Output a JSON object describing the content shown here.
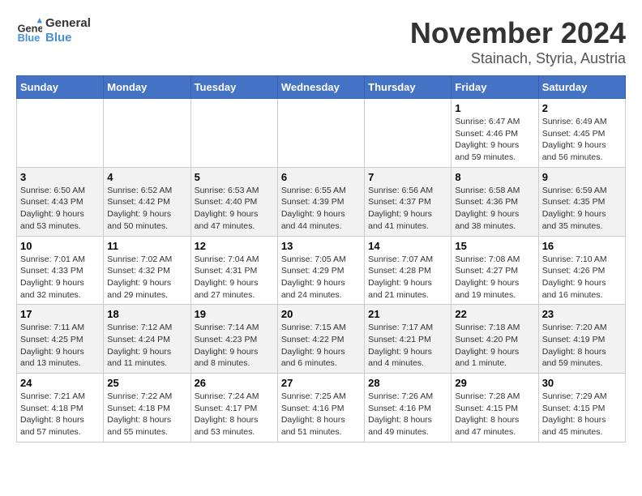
{
  "logo": {
    "line1": "General",
    "line2": "Blue"
  },
  "title": "November 2024",
  "location": "Stainach, Styria, Austria",
  "days_of_week": [
    "Sunday",
    "Monday",
    "Tuesday",
    "Wednesday",
    "Thursday",
    "Friday",
    "Saturday"
  ],
  "weeks": [
    [
      {
        "day": "",
        "info": ""
      },
      {
        "day": "",
        "info": ""
      },
      {
        "day": "",
        "info": ""
      },
      {
        "day": "",
        "info": ""
      },
      {
        "day": "",
        "info": ""
      },
      {
        "day": "1",
        "info": "Sunrise: 6:47 AM\nSunset: 4:46 PM\nDaylight: 9 hours and 59 minutes."
      },
      {
        "day": "2",
        "info": "Sunrise: 6:49 AM\nSunset: 4:45 PM\nDaylight: 9 hours and 56 minutes."
      }
    ],
    [
      {
        "day": "3",
        "info": "Sunrise: 6:50 AM\nSunset: 4:43 PM\nDaylight: 9 hours and 53 minutes."
      },
      {
        "day": "4",
        "info": "Sunrise: 6:52 AM\nSunset: 4:42 PM\nDaylight: 9 hours and 50 minutes."
      },
      {
        "day": "5",
        "info": "Sunrise: 6:53 AM\nSunset: 4:40 PM\nDaylight: 9 hours and 47 minutes."
      },
      {
        "day": "6",
        "info": "Sunrise: 6:55 AM\nSunset: 4:39 PM\nDaylight: 9 hours and 44 minutes."
      },
      {
        "day": "7",
        "info": "Sunrise: 6:56 AM\nSunset: 4:37 PM\nDaylight: 9 hours and 41 minutes."
      },
      {
        "day": "8",
        "info": "Sunrise: 6:58 AM\nSunset: 4:36 PM\nDaylight: 9 hours and 38 minutes."
      },
      {
        "day": "9",
        "info": "Sunrise: 6:59 AM\nSunset: 4:35 PM\nDaylight: 9 hours and 35 minutes."
      }
    ],
    [
      {
        "day": "10",
        "info": "Sunrise: 7:01 AM\nSunset: 4:33 PM\nDaylight: 9 hours and 32 minutes."
      },
      {
        "day": "11",
        "info": "Sunrise: 7:02 AM\nSunset: 4:32 PM\nDaylight: 9 hours and 29 minutes."
      },
      {
        "day": "12",
        "info": "Sunrise: 7:04 AM\nSunset: 4:31 PM\nDaylight: 9 hours and 27 minutes."
      },
      {
        "day": "13",
        "info": "Sunrise: 7:05 AM\nSunset: 4:29 PM\nDaylight: 9 hours and 24 minutes."
      },
      {
        "day": "14",
        "info": "Sunrise: 7:07 AM\nSunset: 4:28 PM\nDaylight: 9 hours and 21 minutes."
      },
      {
        "day": "15",
        "info": "Sunrise: 7:08 AM\nSunset: 4:27 PM\nDaylight: 9 hours and 19 minutes."
      },
      {
        "day": "16",
        "info": "Sunrise: 7:10 AM\nSunset: 4:26 PM\nDaylight: 9 hours and 16 minutes."
      }
    ],
    [
      {
        "day": "17",
        "info": "Sunrise: 7:11 AM\nSunset: 4:25 PM\nDaylight: 9 hours and 13 minutes."
      },
      {
        "day": "18",
        "info": "Sunrise: 7:12 AM\nSunset: 4:24 PM\nDaylight: 9 hours and 11 minutes."
      },
      {
        "day": "19",
        "info": "Sunrise: 7:14 AM\nSunset: 4:23 PM\nDaylight: 9 hours and 8 minutes."
      },
      {
        "day": "20",
        "info": "Sunrise: 7:15 AM\nSunset: 4:22 PM\nDaylight: 9 hours and 6 minutes."
      },
      {
        "day": "21",
        "info": "Sunrise: 7:17 AM\nSunset: 4:21 PM\nDaylight: 9 hours and 4 minutes."
      },
      {
        "day": "22",
        "info": "Sunrise: 7:18 AM\nSunset: 4:20 PM\nDaylight: 9 hours and 1 minute."
      },
      {
        "day": "23",
        "info": "Sunrise: 7:20 AM\nSunset: 4:19 PM\nDaylight: 8 hours and 59 minutes."
      }
    ],
    [
      {
        "day": "24",
        "info": "Sunrise: 7:21 AM\nSunset: 4:18 PM\nDaylight: 8 hours and 57 minutes."
      },
      {
        "day": "25",
        "info": "Sunrise: 7:22 AM\nSunset: 4:18 PM\nDaylight: 8 hours and 55 minutes."
      },
      {
        "day": "26",
        "info": "Sunrise: 7:24 AM\nSunset: 4:17 PM\nDaylight: 8 hours and 53 minutes."
      },
      {
        "day": "27",
        "info": "Sunrise: 7:25 AM\nSunset: 4:16 PM\nDaylight: 8 hours and 51 minutes."
      },
      {
        "day": "28",
        "info": "Sunrise: 7:26 AM\nSunset: 4:16 PM\nDaylight: 8 hours and 49 minutes."
      },
      {
        "day": "29",
        "info": "Sunrise: 7:28 AM\nSunset: 4:15 PM\nDaylight: 8 hours and 47 minutes."
      },
      {
        "day": "30",
        "info": "Sunrise: 7:29 AM\nSunset: 4:15 PM\nDaylight: 8 hours and 45 minutes."
      }
    ]
  ]
}
